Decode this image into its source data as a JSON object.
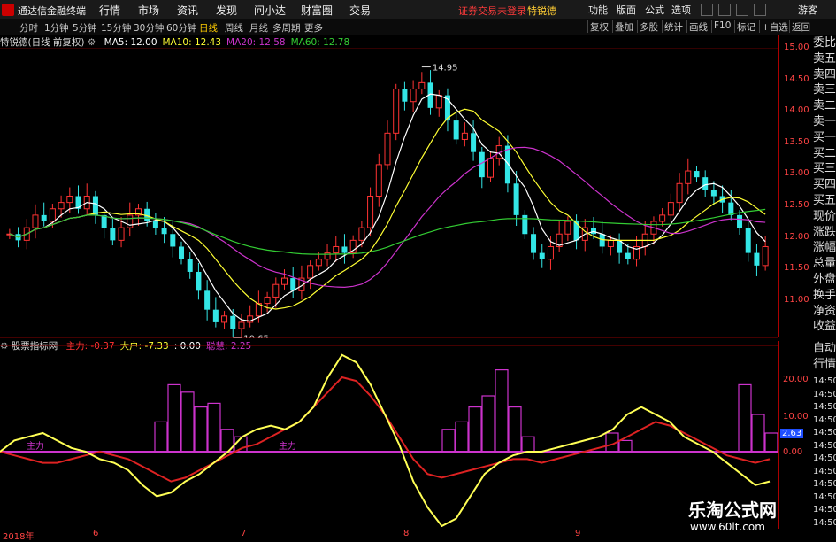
{
  "menubar": {
    "app_title": "通达信金融终端",
    "items": [
      "行情",
      "市场",
      "资讯",
      "发现",
      "问小达",
      "财富圈",
      "交易"
    ],
    "login_status": "证券交易未登录",
    "stock_name": "特锐德",
    "right_items": [
      "功能",
      "版面",
      "公式",
      "选项"
    ],
    "guest": "游客"
  },
  "toolbar": {
    "periods": [
      "分时",
      "1分钟",
      "5分钟",
      "15分钟",
      "30分钟",
      "60分钟",
      "日线",
      "周线",
      "月线",
      "多周期",
      "更多"
    ],
    "active_period": "日线",
    "buttons": [
      "复权",
      "叠加",
      "多股",
      "统计",
      "画线",
      "F10",
      "标记",
      "+自选",
      "返回"
    ]
  },
  "infobar": {
    "title": "特锐德(日线 前复权)",
    "ma": [
      {
        "label": "MA5: 12.00",
        "color": "#ffffff"
      },
      {
        "label": "MA10: 12.43",
        "color": "#ffff33"
      },
      {
        "label": "MA20: 12.58",
        "color": "#cc33cc"
      },
      {
        "label": "MA60: 12.78",
        "color": "#33cc33"
      }
    ]
  },
  "price_axis": {
    "ticks": [
      "15.00",
      "14.50",
      "14.00",
      "13.50",
      "13.00",
      "12.50",
      "12.00",
      "11.50",
      "11.00"
    ]
  },
  "annotations": {
    "high": "14.95",
    "low": "10.65"
  },
  "indicator": {
    "name": "股票指标网",
    "items": [
      {
        "label": "主力: -0.37",
        "color": "#ff3333"
      },
      {
        "label": "大户: -7.33",
        "color": "#ffff33"
      },
      {
        "label": ": 0.00",
        "color": "#ffffff"
      },
      {
        "label": "聪慧: 2.25",
        "color": "#cc33cc"
      }
    ],
    "zero_label": "主力",
    "ticks": [
      "20.00",
      "10.00",
      "0.00"
    ],
    "current_value": "2.63"
  },
  "side_tabs": [
    "委比",
    "卖五",
    "卖四",
    "卖三",
    "卖二",
    "卖一",
    "买一",
    "买二",
    "买三",
    "买四",
    "买五",
    "现价",
    "涨跌",
    "涨幅",
    "总量",
    "外盘",
    "换手",
    "净资",
    "收益"
  ],
  "side_tabs2": [
    "自动",
    "行情"
  ],
  "right_time_labels": [
    "14:50",
    "14:50",
    "14:50",
    "14:50",
    "14:50",
    "14:50",
    "14:50",
    "14:50",
    "14:50",
    "14:50",
    "14:50",
    "14:50"
  ],
  "date_axis": [
    "2018年",
    "6",
    "7",
    "8",
    "9"
  ],
  "watermark": {
    "title": "乐淘公式网",
    "url": "www.60lt.com"
  },
  "colors": {
    "up": "#ff3333",
    "down": "#33e6e6",
    "ma5": "#ffffff",
    "ma10": "#ffff33",
    "ma20": "#cc33cc",
    "ma60": "#33cc33",
    "axis": "#aa0000"
  }
}
